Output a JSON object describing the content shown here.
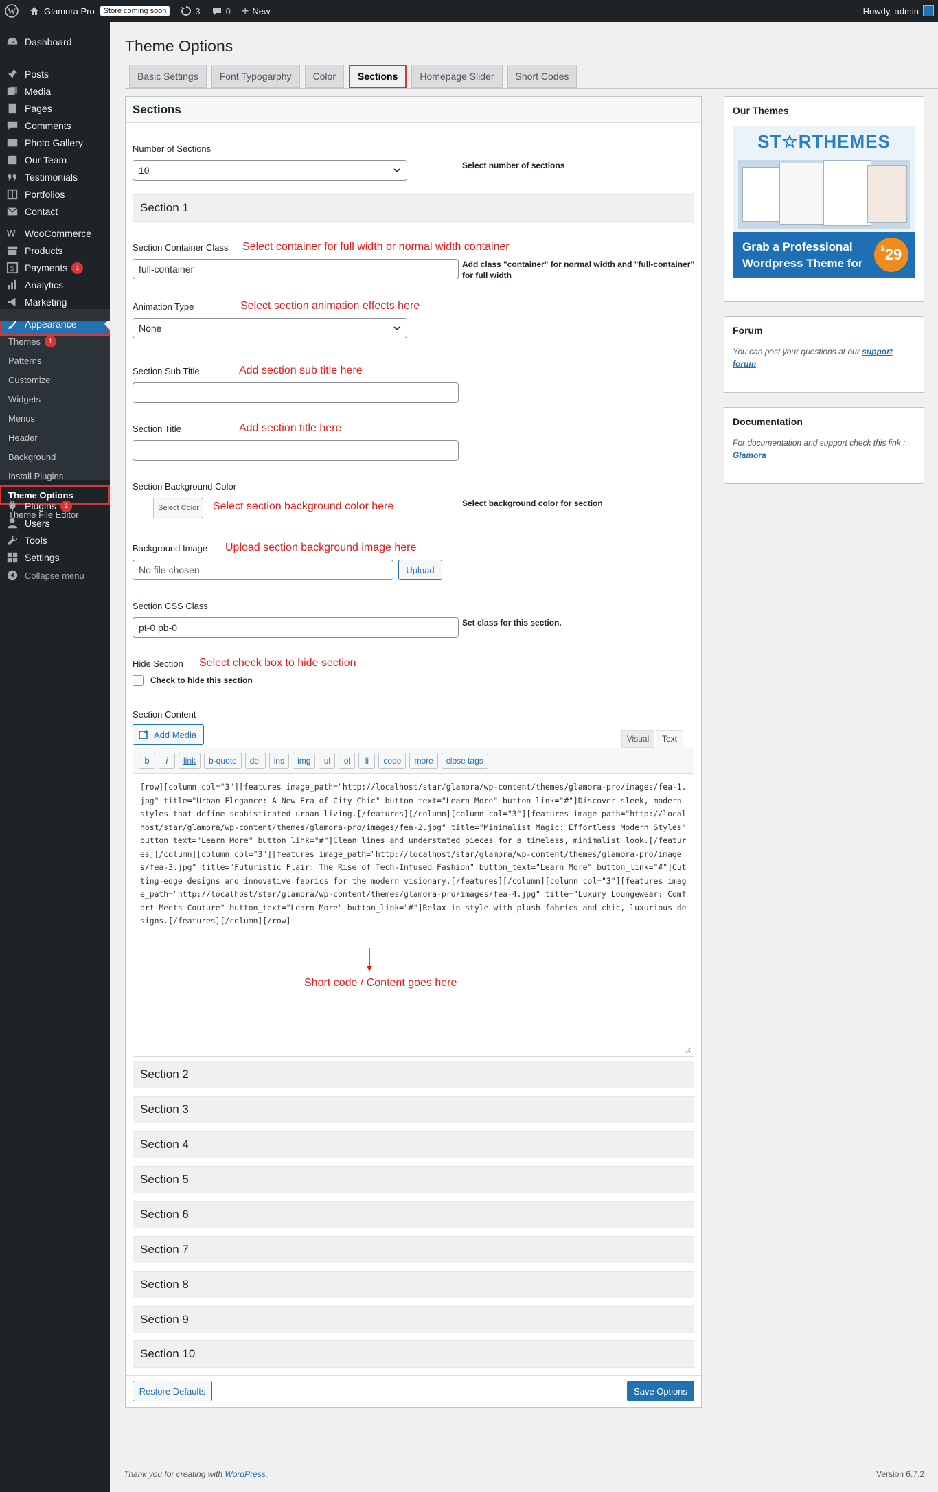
{
  "adminbar": {
    "site_name": "Glamora Pro",
    "store_badge": "Store coming soon",
    "updates_count": "3",
    "comments_count": "0",
    "new_label": "New",
    "howdy": "Howdy, admin"
  },
  "sidebar": {
    "items": [
      {
        "label": "Dashboard",
        "icon": "dashboard-icon"
      },
      {
        "label": "Posts",
        "icon": "pin-icon"
      },
      {
        "label": "Media",
        "icon": "media-icon"
      },
      {
        "label": "Pages",
        "icon": "page-icon"
      },
      {
        "label": "Comments",
        "icon": "comment-icon"
      },
      {
        "label": "Photo Gallery",
        "icon": "gallery-icon"
      },
      {
        "label": "Our Team",
        "icon": "team-icon"
      },
      {
        "label": "Testimonials",
        "icon": "quote-icon"
      },
      {
        "label": "Portfolios",
        "icon": "portfolio-icon"
      },
      {
        "label": "Contact",
        "icon": "mail-icon"
      },
      {
        "label": "WooCommerce",
        "icon": "woo-icon"
      },
      {
        "label": "Products",
        "icon": "archive-icon"
      },
      {
        "label": "Payments",
        "icon": "dollar-icon",
        "badge": "1"
      },
      {
        "label": "Analytics",
        "icon": "chart-icon"
      },
      {
        "label": "Marketing",
        "icon": "megaphone-icon"
      },
      {
        "label": "Appearance",
        "icon": "brush-icon"
      },
      {
        "label": "Plugins",
        "icon": "plugin-icon",
        "badge": "2"
      },
      {
        "label": "Users",
        "icon": "user-icon"
      },
      {
        "label": "Tools",
        "icon": "wrench-icon"
      },
      {
        "label": "Settings",
        "icon": "settings-icon"
      },
      {
        "label": "Collapse menu",
        "icon": "collapse-icon"
      }
    ],
    "submenu": [
      {
        "label": "Themes",
        "badge": "1"
      },
      {
        "label": "Patterns"
      },
      {
        "label": "Customize"
      },
      {
        "label": "Widgets"
      },
      {
        "label": "Menus"
      },
      {
        "label": "Header"
      },
      {
        "label": "Background"
      },
      {
        "label": "Install Plugins"
      },
      {
        "label": "Theme Options"
      },
      {
        "label": "Theme File Editor"
      }
    ]
  },
  "page": {
    "title": "Theme Options",
    "tabs": [
      "Basic Settings",
      "Font Typogarphy",
      "Color",
      "Sections",
      "Homepage Slider",
      "Short Codes"
    ],
    "active_tab": "Sections"
  },
  "panel": {
    "title": "Sections",
    "num_sections_label": "Number of Sections",
    "num_sections_value": "10",
    "num_sections_desc": "Select number of sections",
    "section1_title": "Section 1",
    "container_label": "Section Container Class",
    "container_annot": "Select container for full width or normal width container",
    "container_value": "full-container",
    "container_desc": "Add class \"container\" for normal width and \"full-container\" for full width",
    "animation_label": "Animation Type",
    "animation_annot": "Select section animation effects here",
    "animation_value": "None",
    "subtitle_label": "Section Sub Title",
    "subtitle_annot": "Add section sub title here",
    "title_label": "Section Title",
    "title_annot": "Add section title here",
    "bgcolor_label": "Section Background Color",
    "bgcolor_button": "Select Color",
    "bgcolor_annot": "Select section background color here",
    "bgcolor_desc": "Select background color for section",
    "bgimage_label": "Background Image",
    "bgimage_annot": "Upload section background image here",
    "bgimage_placeholder": "No file chosen",
    "upload_button": "Upload",
    "css_label": "Section CSS Class",
    "css_value": "pt-0 pb-0",
    "css_desc": "Set class for this section.",
    "hide_label": "Hide Section",
    "hide_annot": "Select check box to hide section",
    "hide_checkbox_label": "Check to hide this section",
    "content_label": "Section Content",
    "add_media": "Add Media",
    "visual_tab": "Visual",
    "text_tab": "Text",
    "quicktags": [
      "b",
      "i",
      "link",
      "b-quote",
      "del",
      "ins",
      "img",
      "ul",
      "ol",
      "li",
      "code",
      "more",
      "close tags"
    ],
    "content": "[row][column col=\"3\"][features image_path=\"http://localhost/star/glamora/wp-content/themes/glamora-pro/images/fea-1.jpg\" title=\"Urban Elegance: A New Era of City Chic\" button_text=\"Learn More\" button_link=\"#\"]Discover sleek, modern styles that define sophisticated urban living.[/features][/column][column col=\"3\"][features image_path=\"http://localhost/star/glamora/wp-content/themes/glamora-pro/images/fea-2.jpg\" title=\"Minimalist Magic: Effortless Modern Styles\" button_text=\"Learn More\" button_link=\"#\"]Clean lines and understated pieces for a timeless, minimalist look.[/features][/column][column col=\"3\"][features image_path=\"http://localhost/star/glamora/wp-content/themes/glamora-pro/images/fea-3.jpg\" title=\"Futuristic Flair: The Rise of Tech-Infused Fashion\" button_text=\"Learn More\" button_link=\"#\"]Cutting-edge designs and innovative fabrics for the modern visionary.[/features][/column][column col=\"3\"][features image_path=\"http://localhost/star/glamora/wp-content/themes/glamora-pro/images/fea-4.jpg\" title=\"Luxury Loungewear: Comfort Meets Couture\" button_text=\"Learn More\" button_link=\"#\"]Relax in style with plush fabrics and chic, luxurious designs.[/features][/column][/row]",
    "content_annot": "Short code / Content goes here",
    "sections": [
      "Section 2",
      "Section 3",
      "Section 4",
      "Section 5",
      "Section 6",
      "Section 7",
      "Section 8",
      "Section 9",
      "Section 10"
    ],
    "restore_button": "Restore Defaults",
    "save_button": "Save Options"
  },
  "sidebox": {
    "themes_title": "Our Themes",
    "banner_logo_1": "ST",
    "banner_logo_2": "RTHEMES",
    "banner_line1": "Grab a Professional",
    "banner_line2": "Wordpress Theme for",
    "banner_price": "29",
    "banner_currency": "$",
    "forum_title": "Forum",
    "forum_text": "You can post your questions at our",
    "forum_link": "support forum",
    "doc_title": "Documentation",
    "doc_text": "For documentation and support check this link :",
    "doc_link": "Glamora"
  },
  "footer": {
    "thanks_text": "Thank you for creating with",
    "wp_link": "WordPress",
    "version": "Version 6.7.2"
  },
  "colors": {
    "admin_dark": "#1d2327",
    "accent_blue": "#2271b1",
    "annotation_red": "#e01e1e",
    "badge_red": "#d63638"
  }
}
